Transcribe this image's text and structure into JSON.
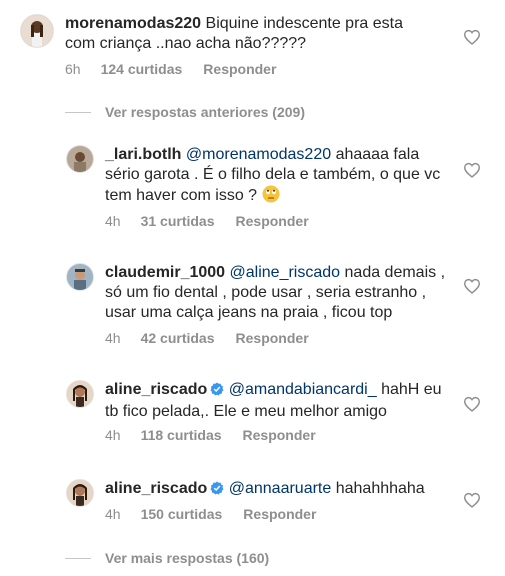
{
  "comments": [
    {
      "username": "morenamodas220",
      "text": "Biquine indescente pra esta com criança ..nao acha não?????",
      "time": "6h",
      "likes": "124 curtidas",
      "reply": "Responder"
    },
    {
      "username": "_lari.botlh",
      "mention": "@morenamodas220",
      "text": "ahaaaa fala sério garota . É o filho dela e também, o que vc tem haver com isso ?",
      "emoji": "eye-roll-emoji",
      "time": "4h",
      "likes": "31 curtidas",
      "reply": "Responder"
    },
    {
      "username": "claudemir_1000",
      "mention": "@aline_riscado",
      "text": "nada demais , só um fio dental , pode usar , seria estranho ,  usar uma calça jeans na praia , ficou top",
      "time": "4h",
      "likes": "42 curtidas",
      "reply": "Responder"
    },
    {
      "username": "aline_riscado",
      "mention": "@amandabiancardi_",
      "text": "hahH eu tb fico pelada,. Ele e meu melhor amigo",
      "time": "4h",
      "likes": "118 curtidas",
      "reply": "Responder"
    },
    {
      "username": "aline_riscado",
      "mention": "@annaaruarte",
      "text": "hahahhhaha",
      "time": "4h",
      "likes": "150 curtidas",
      "reply": "Responder"
    }
  ],
  "links": {
    "previous": "Ver respostas anteriores (209)",
    "more": "Ver mais respostas (160)"
  },
  "icons": {
    "heart": "heart-outline-icon",
    "verified": "verified-badge-icon"
  },
  "colors": {
    "text": "#262626",
    "secondary": "#8e8e8e",
    "mention": "#003569",
    "verified": "#3897f0"
  }
}
